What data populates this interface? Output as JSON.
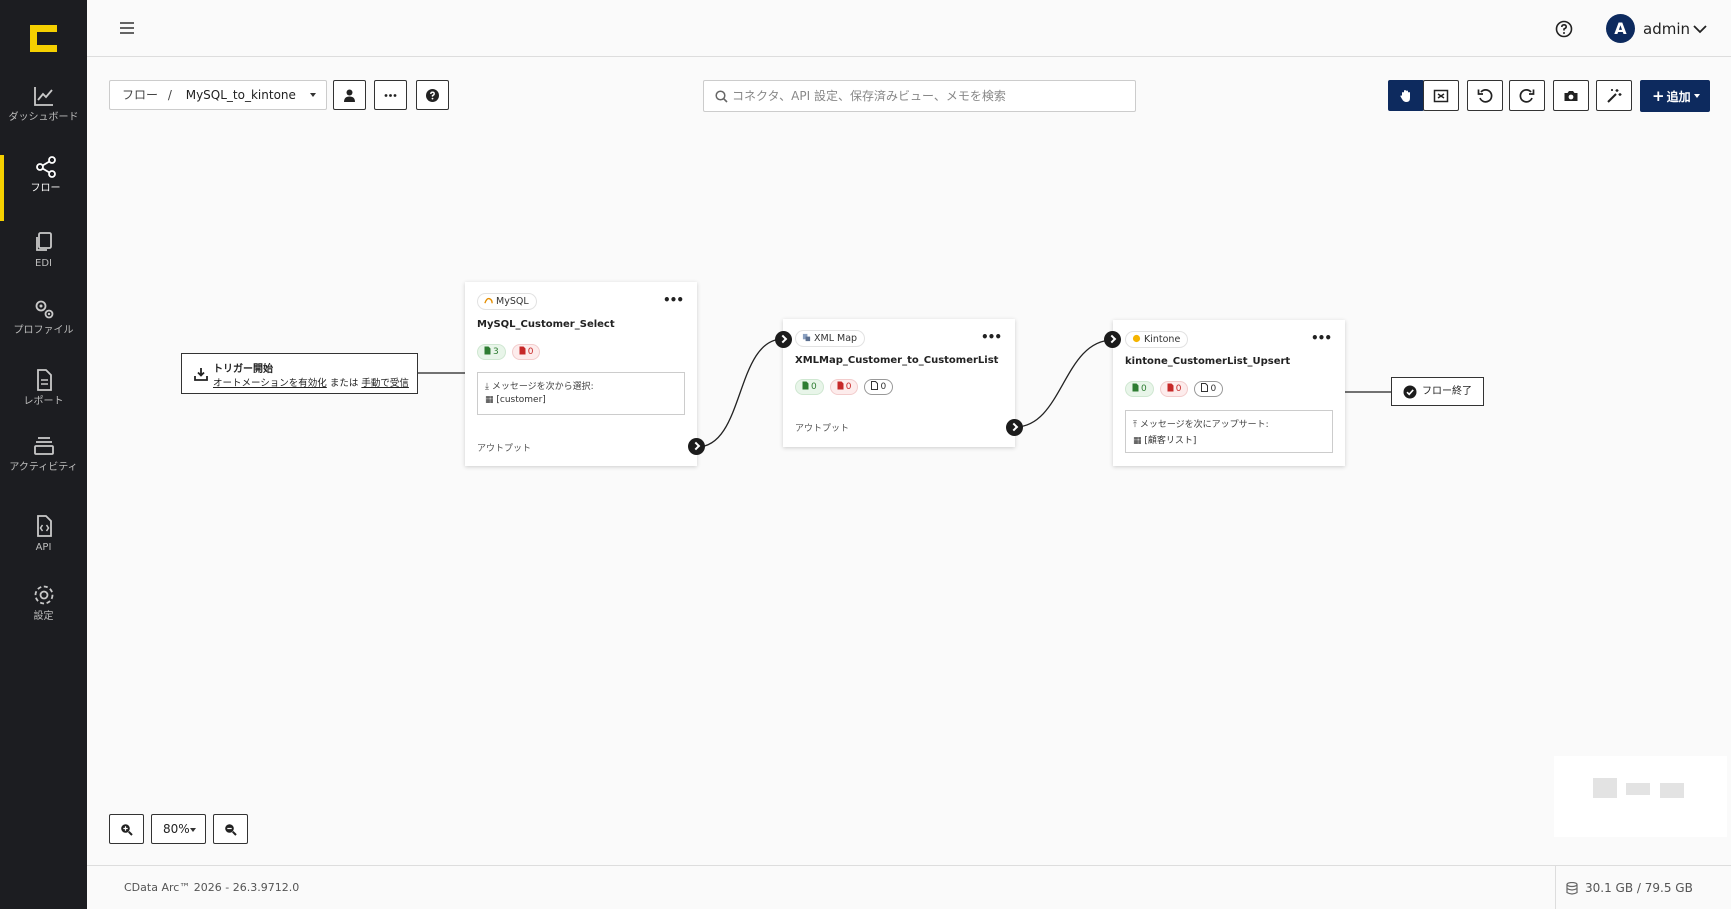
{
  "sidebar": {
    "items": [
      {
        "label": "ダッシュボード"
      },
      {
        "label": "フロー"
      },
      {
        "label": "EDI"
      },
      {
        "label": "プロファイル"
      },
      {
        "label": "レポート"
      },
      {
        "label": "アクティビティ"
      },
      {
        "label": "API"
      },
      {
        "label": "設定"
      }
    ],
    "active_index": 1,
    "accent_color": "#f5d000"
  },
  "header": {
    "avatar_initial": "A",
    "username": "admin"
  },
  "toolbar": {
    "breadcrumb_root": "フロー",
    "breadcrumb_separator": "/",
    "flow_name": "MySQL_to_kintone",
    "search_placeholder": "コネクタ、API 設定、保存済みビュー、メモを検索",
    "add_label": "追加",
    "add_plus": "+"
  },
  "flow": {
    "trigger": {
      "title": "トリガー開始",
      "link_auto": "オートメーションを有効化",
      "or_text": "または",
      "link_manual": "手動で受信"
    },
    "nodes": [
      {
        "connector": "MySQL",
        "name": "MySQL_Customer_Select",
        "counts": [
          {
            "kind": "green",
            "value": "3"
          },
          {
            "kind": "red",
            "value": "0"
          }
        ],
        "message_label": "メッセージを次から選択:",
        "message_value": "[customer]",
        "output_label": "アウトプット"
      },
      {
        "connector": "XML Map",
        "name": "XMLMap_Customer_to_CustomerList",
        "counts": [
          {
            "kind": "green",
            "value": "0"
          },
          {
            "kind": "red",
            "value": "0"
          },
          {
            "kind": "gray",
            "value": "0"
          }
        ],
        "output_label": "アウトプット"
      },
      {
        "connector": "Kintone",
        "name": "kintone_CustomerList_Upsert",
        "counts": [
          {
            "kind": "green",
            "value": "0"
          },
          {
            "kind": "red",
            "value": "0"
          },
          {
            "kind": "gray",
            "value": "0"
          }
        ],
        "message_label": "メッセージを次にアップサート:",
        "message_value": "[顧客リスト]"
      }
    ],
    "end_label": "フロー終了"
  },
  "zoom": {
    "level": "80%"
  },
  "footer": {
    "version": "CData Arc™ 2026 - 26.3.9712.0",
    "storage": "30.1 GB / 79.5 GB"
  },
  "colors": {
    "primary": "#0d2a5e",
    "sidebar_bg": "#1c1d21",
    "success": "#2e7d32",
    "error": "#c62828"
  }
}
